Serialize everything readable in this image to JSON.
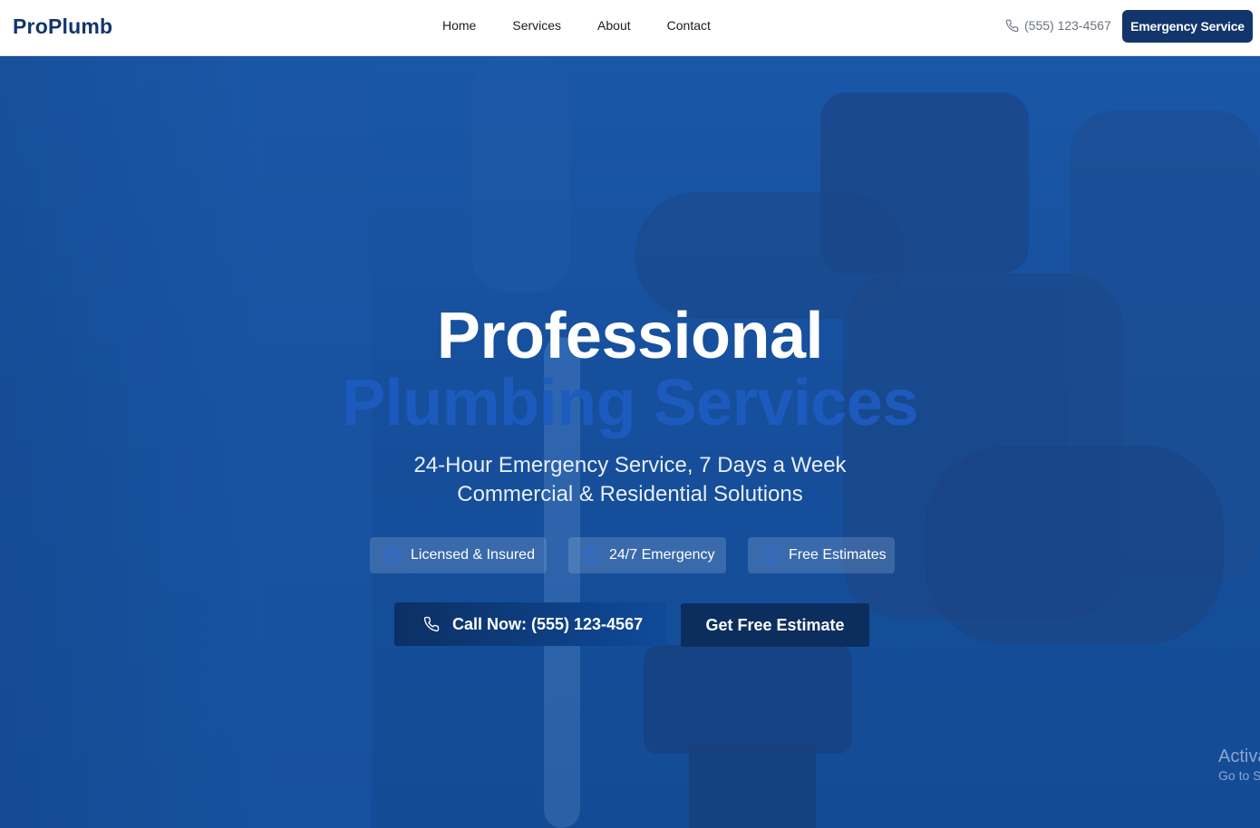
{
  "header": {
    "logo": "ProPlumb",
    "nav": [
      "Home",
      "Services",
      "About",
      "Contact"
    ],
    "phone": "(555) 123-4567",
    "emergency_button": "Emergency Service"
  },
  "hero": {
    "title_line1": "Professional",
    "title_line2": "Plumbing Services",
    "subtitle_line1": "24-Hour Emergency Service, 7 Days a Week",
    "subtitle_line2": "Commercial & Residential Solutions",
    "badges": [
      {
        "label": "Licensed & Insured",
        "icon": "check-circle-icon"
      },
      {
        "label": "24/7 Emergency",
        "icon": "clock-icon"
      },
      {
        "label": "Free Estimates",
        "icon": "check-circle-icon"
      }
    ],
    "call_button": "Call Now: (555) 123-4567",
    "estimate_button": "Get Free Estimate"
  },
  "overlay": {
    "activate_line1": "Activate Windows",
    "activate_line2": "Go to Settings to activate Windows."
  },
  "colors": {
    "brand": "#12356b",
    "hero_blue": "#164f9c",
    "accent_title": "#1e5bc0"
  }
}
